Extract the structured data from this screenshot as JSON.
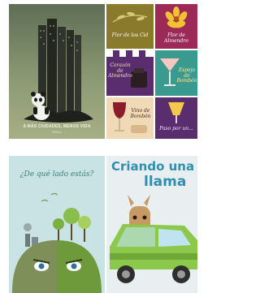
{
  "posters": {
    "panda": {
      "caption": "A MÁS CIUDADES, MENOS VIDA",
      "credit": "PANDA"
    },
    "grid": {
      "cells": [
        {
          "label": "Flor de los Cid",
          "bg": "#8a7a2b"
        },
        {
          "label": "Flor de Almendro",
          "bg": "#9c2a57"
        },
        {
          "label": "Corazón de Almendro",
          "bg": "#5a2e6e"
        },
        {
          "label": "Espejo de Bombón",
          "bg": "#3a9a8f"
        },
        {
          "label": "Vino de Bombón",
          "bg": "#f0d9b5"
        },
        {
          "label": "Paso por un...",
          "bg": "#5a2e6e"
        }
      ]
    },
    "planet": {
      "headline": "¿De qué lado estás?"
    },
    "llama": {
      "title_line1": "Criando una",
      "title_line2": "llama"
    }
  },
  "colors": {
    "panda_bg": "#7a8a66",
    "planet_bg": "#c9e3e4",
    "llama_bg": "#e9eff0",
    "car_green": "#8cc84b",
    "llama_title": "#2f8fb0"
  }
}
